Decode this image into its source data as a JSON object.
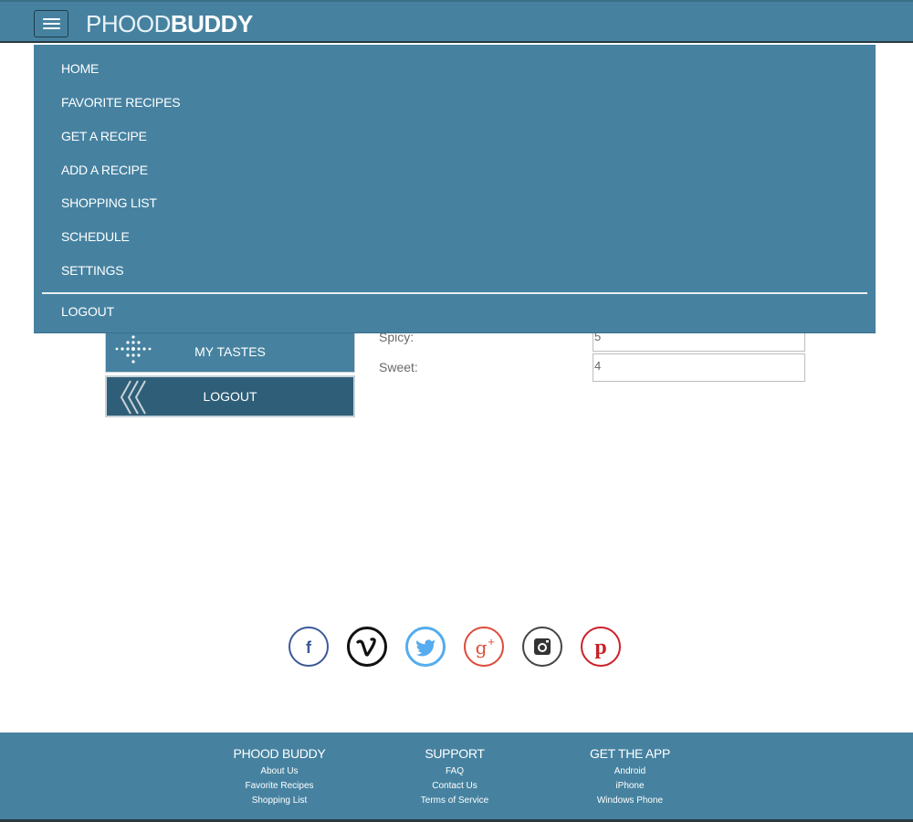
{
  "header": {
    "brand_light": "PHOOD",
    "brand_bold": "BUDDY",
    "accent_color": "#4682a0"
  },
  "menu": {
    "items": [
      "HOME",
      "FAVORITE RECIPES",
      "GET A RECIPE",
      "ADD A RECIPE",
      "SHOPPING LIST",
      "SCHEDULE",
      "SETTINGS"
    ],
    "logout": "LOGOUT"
  },
  "sidebar": {
    "my_tastes": "MY TASTES",
    "logout": "LOGOUT"
  },
  "tastes_form": {
    "spicy_label": "Spicy:",
    "spicy_value": "5",
    "sweet_label": "Sweet:",
    "sweet_value": "4"
  },
  "social": {
    "icons": [
      "facebook-icon",
      "vimeo-icon",
      "twitter-icon",
      "google-plus-icon",
      "instagram-icon",
      "pinterest-icon"
    ]
  },
  "footer": {
    "columns": [
      {
        "title": "PHOOD BUDDY",
        "links": [
          "About Us",
          "Favorite Recipes",
          "Shopping List"
        ]
      },
      {
        "title": "SUPPORT",
        "links": [
          "FAQ",
          "Contact Us",
          "Terms of Service"
        ]
      },
      {
        "title": "GET THE APP",
        "links": [
          "Android",
          "iPhone",
          "Windows Phone"
        ]
      }
    ]
  }
}
